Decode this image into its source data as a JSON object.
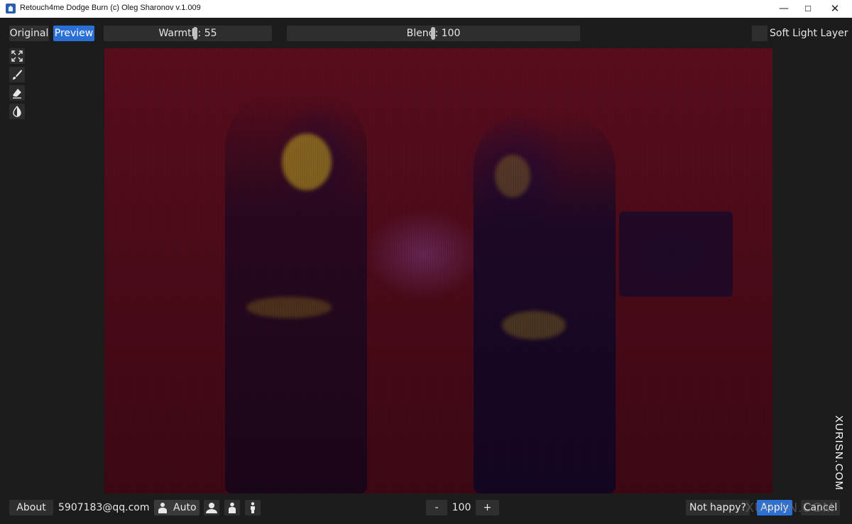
{
  "window": {
    "title": "Retouch4me Dodge Burn (c) Oleg Sharonov v.1.009",
    "minimize_glyph": "—",
    "maximize_glyph": "☐",
    "close_glyph": "✕"
  },
  "toolbar": {
    "original_label": "Original",
    "preview_label": "Preview",
    "warmth_text": "Warmth: 55",
    "warmth_value": 55,
    "blend_text": "Blend: 100",
    "blend_value": 100,
    "soft_light_label": "Soft Light Layer",
    "soft_light_checked": false
  },
  "tools": [
    {
      "name": "fit-screen-icon"
    },
    {
      "name": "brush-icon"
    },
    {
      "name": "eraser-icon"
    },
    {
      "name": "contrast-icon"
    }
  ],
  "bottom": {
    "about_label": "About",
    "email": "5907183@qq.com",
    "auto_label": "Auto",
    "zoom_minus": "-",
    "zoom_value": "100",
    "zoom_plus": "+",
    "not_happy_label": "Not happy?",
    "apply_label": "Apply",
    "cancel_label": "Cancel"
  },
  "watermark": {
    "vertical": "XURISN.COM",
    "horizontal": "XURISN.COM"
  },
  "colors": {
    "accent": "#2a6fd6",
    "panel": "#2f2f2f",
    "background": "#1c1c1c"
  }
}
